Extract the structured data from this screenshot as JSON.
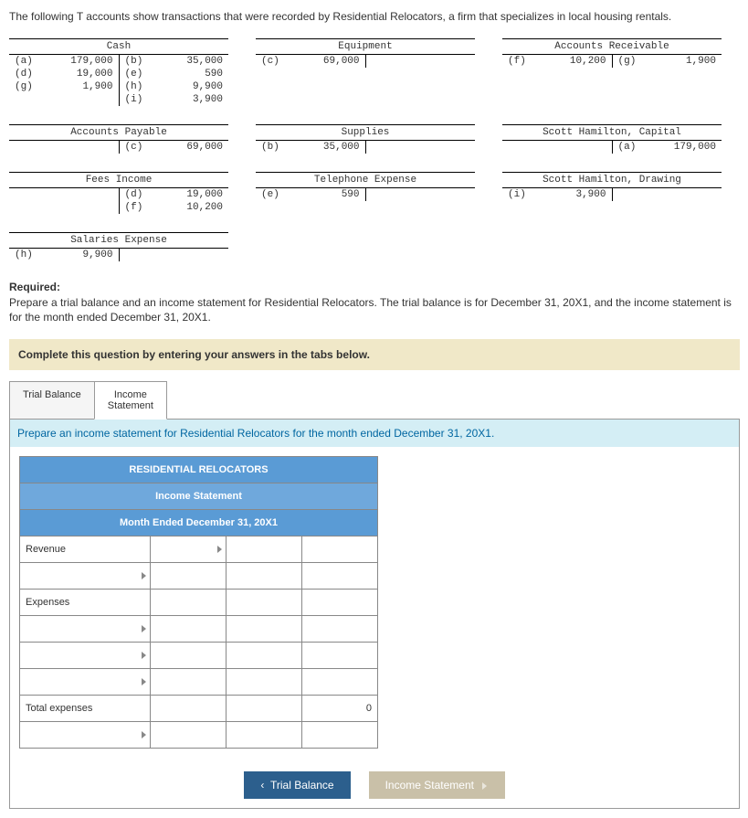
{
  "intro": "The following T accounts show transactions that were recorded by Residential Relocators, a firm that specializes in local housing rentals.",
  "t_accounts": {
    "row1": [
      {
        "title": "Cash",
        "debits": [
          {
            "ref": "(a)",
            "amt": "179,000"
          },
          {
            "ref": "(d)",
            "amt": "19,000"
          },
          {
            "ref": "(g)",
            "amt": "1,900"
          }
        ],
        "credits": [
          {
            "ref": "(b)",
            "amt": "35,000"
          },
          {
            "ref": "(e)",
            "amt": "590"
          },
          {
            "ref": "(h)",
            "amt": "9,900"
          },
          {
            "ref": "(i)",
            "amt": "3,900"
          }
        ]
      },
      {
        "title": "Equipment",
        "debits": [
          {
            "ref": "(c)",
            "amt": "69,000"
          }
        ],
        "credits": []
      },
      {
        "title": "Accounts Receivable",
        "debits": [
          {
            "ref": "(f)",
            "amt": "10,200"
          }
        ],
        "credits": [
          {
            "ref": "(g)",
            "amt": "1,900"
          }
        ]
      }
    ],
    "row2": [
      {
        "title": "Accounts Payable",
        "debits": [],
        "credits": [
          {
            "ref": "(c)",
            "amt": "69,000"
          }
        ]
      },
      {
        "title": "Supplies",
        "debits": [
          {
            "ref": "(b)",
            "amt": "35,000"
          }
        ],
        "credits": []
      },
      {
        "title": "Scott Hamilton, Capital",
        "debits": [],
        "credits": [
          {
            "ref": "(a)",
            "amt": "179,000"
          }
        ]
      }
    ],
    "row3": [
      {
        "title": "Fees Income",
        "debits": [],
        "credits": [
          {
            "ref": "(d)",
            "amt": "19,000"
          },
          {
            "ref": "(f)",
            "amt": "10,200"
          }
        ]
      },
      {
        "title": "Telephone Expense",
        "debits": [
          {
            "ref": "(e)",
            "amt": "590"
          }
        ],
        "credits": []
      },
      {
        "title": "Scott Hamilton, Drawing",
        "debits": [
          {
            "ref": "(i)",
            "amt": "3,900"
          }
        ],
        "credits": []
      }
    ],
    "row4": [
      {
        "title": "Salaries Expense",
        "debits": [
          {
            "ref": "(h)",
            "amt": "9,900"
          }
        ],
        "credits": []
      }
    ]
  },
  "required_label": "Required:",
  "required_text": "Prepare a trial balance and an income statement for Residential Relocators. The trial balance is for December 31, 20X1, and the income statement is for the month ended December 31, 20X1.",
  "instruction": "Complete this question by entering your answers in the tabs below.",
  "tabs": {
    "trial_balance": "Trial Balance",
    "income_statement_l1": "Income",
    "income_statement_l2": "Statement"
  },
  "tab_prompt": "Prepare an income statement for Residential Relocators for the month ended December 31, 20X1.",
  "income_table": {
    "header1": "RESIDENTIAL RELOCATORS",
    "header2": "Income Statement",
    "header3": "Month Ended December 31, 20X1",
    "revenue_label": "Revenue",
    "expenses_label": "Expenses",
    "total_expenses_label": "Total expenses",
    "total_expenses_value": "0"
  },
  "nav": {
    "prev": "Trial Balance",
    "next": "Income Statement"
  }
}
